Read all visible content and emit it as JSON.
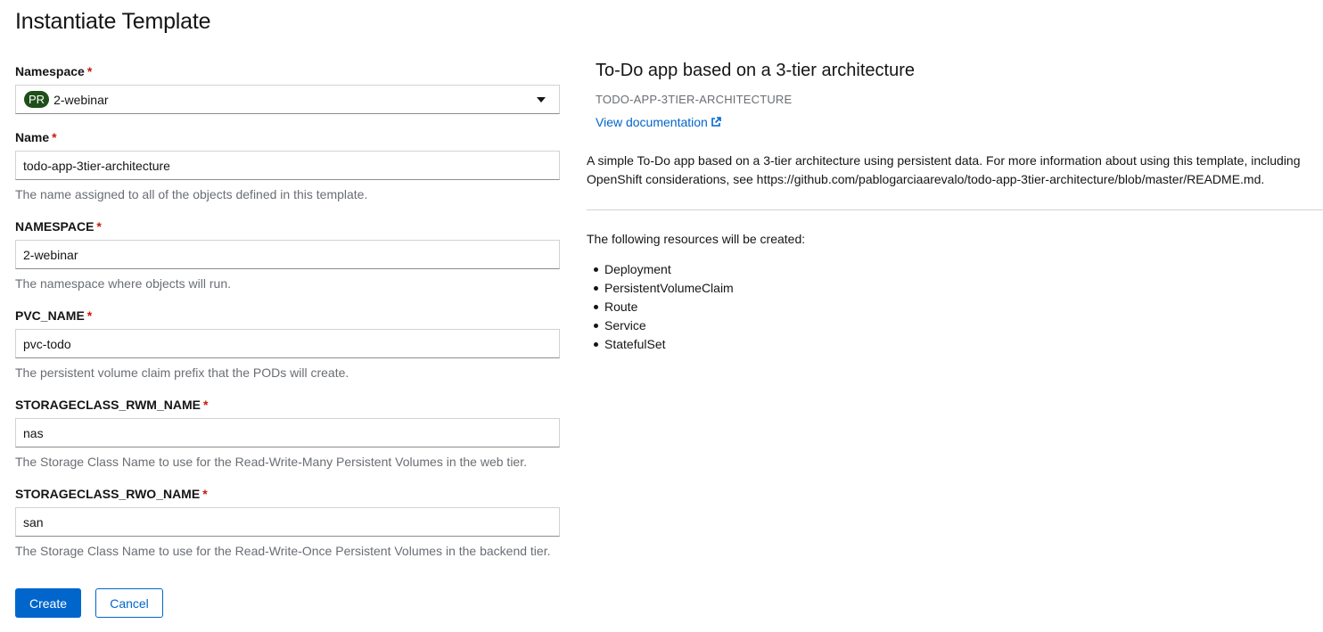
{
  "page": {
    "title": "Instantiate Template"
  },
  "form": {
    "namespace_select": {
      "label": "Namespace",
      "badge": "PR",
      "value": "2-webinar"
    },
    "fields": [
      {
        "label": "Name",
        "value": "todo-app-3tier-architecture",
        "helper": "The name assigned to all of the objects defined in this template."
      },
      {
        "label": "NAMESPACE",
        "value": "2-webinar",
        "helper": "The namespace where objects will run."
      },
      {
        "label": "PVC_NAME",
        "value": "pvc-todo",
        "helper": "The persistent volume claim prefix that the PODs will create."
      },
      {
        "label": "STORAGECLASS_RWM_NAME",
        "value": "nas",
        "helper": "The Storage Class Name to use for the Read-Write-Many Persistent Volumes in the web tier."
      },
      {
        "label": "STORAGECLASS_RWO_NAME",
        "value": "san",
        "helper": "The Storage Class Name to use for the Read-Write-Once Persistent Volumes in the backend tier."
      }
    ],
    "required_marker": "*",
    "create_label": "Create",
    "cancel_label": "Cancel"
  },
  "template": {
    "title": "To-Do app based on a 3-tier architecture",
    "id": "TODO-APP-3TIER-ARCHITECTURE",
    "doc_link": "View documentation",
    "description": "A simple To-Do app based on a 3-tier architecture using persistent data. For more information about using this template, including OpenShift considerations, see https://github.com/pablogarciaarevalo/todo-app-3tier-architecture/blob/master/README.md.",
    "resources_heading": "The following resources will be created:",
    "resources": [
      "Deployment",
      "PersistentVolumeClaim",
      "Route",
      "Service",
      "StatefulSet"
    ]
  },
  "colors": {
    "primary": "#0066cc",
    "required": "#c9190b",
    "badge": "#1e4f18"
  },
  "icons": {
    "external_link": "external-link-icon",
    "caret": "caret-down-icon"
  }
}
